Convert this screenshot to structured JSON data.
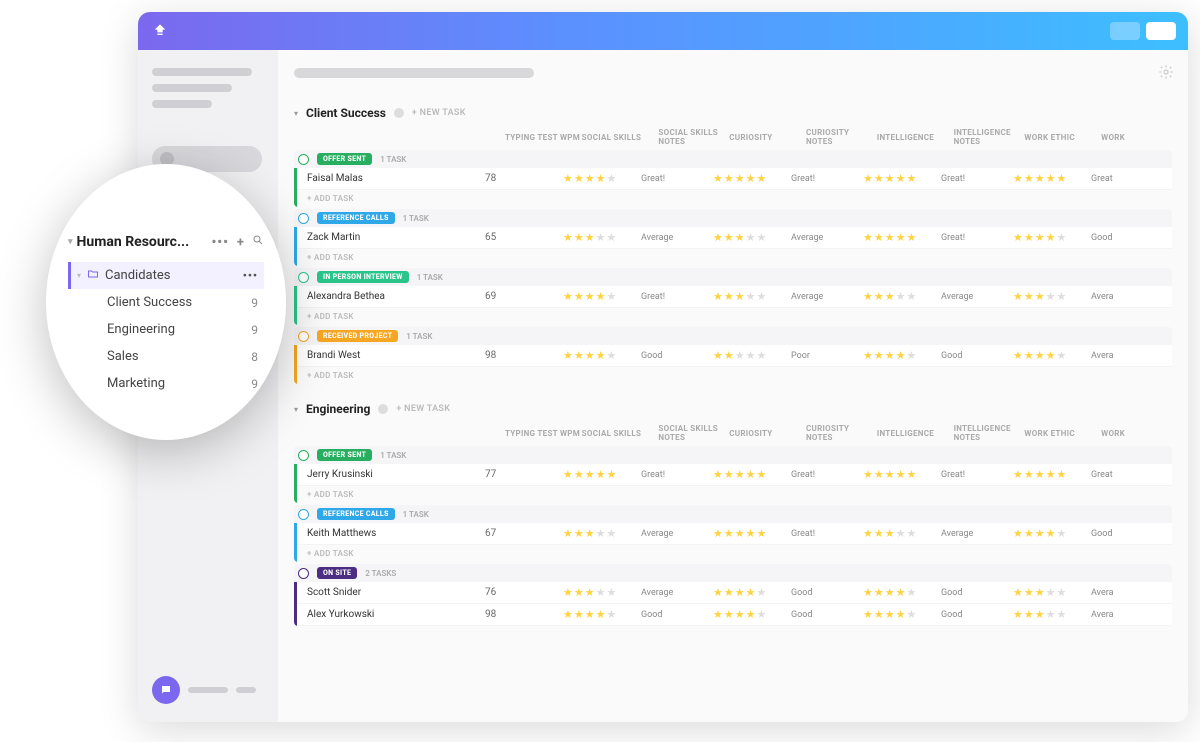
{
  "colors": {
    "offer_sent": "#27AE60",
    "reference_calls": "#2EA8E6",
    "in_person": "#2BC48A",
    "received": "#F5A623",
    "on_site": "#4B2E83"
  },
  "labels": {
    "new_task": "+ NEW TASK",
    "add_task": "+ ADD TASK",
    "task_singular": "1 TASK",
    "tasks_2": "2 TASKS"
  },
  "columns": [
    "TYPING TEST WPM",
    "SOCIAL SKILLS",
    "SOCIAL SKILLS NOTES",
    "CURIOSITY",
    "CURIOSITY NOTES",
    "INTELLIGENCE",
    "INTELLIGENCE NOTES",
    "WORK ETHIC",
    "WORK"
  ],
  "groups": [
    {
      "id": "client-success",
      "name": "Client Success",
      "statuses": [
        {
          "key": "offer_sent",
          "label": "OFFER SENT",
          "color": "#27AE60",
          "count": "1 TASK",
          "rows": [
            {
              "name": "Faisal Malas",
              "typing": "78",
              "stars": [
                4,
                5,
                5,
                5
              ],
              "notes": [
                "Great!",
                "Great!",
                "Great!",
                "Great"
              ]
            }
          ]
        },
        {
          "key": "reference_calls",
          "label": "REFERENCE CALLS",
          "color": "#2EA8E6",
          "count": "1 TASK",
          "rows": [
            {
              "name": "Zack Martin",
              "typing": "65",
              "stars": [
                3,
                3,
                5,
                4
              ],
              "notes": [
                "Average",
                "Average",
                "Great!",
                "Good"
              ]
            }
          ]
        },
        {
          "key": "in_person",
          "label": "IN PERSON INTERVIEW",
          "color": "#2BC48A",
          "count": "1 TASK",
          "rows": [
            {
              "name": "Alexandra Bethea",
              "typing": "69",
              "stars": [
                4,
                3,
                3,
                3
              ],
              "notes": [
                "Great!",
                "Average",
                "Average",
                "Avera"
              ]
            }
          ]
        },
        {
          "key": "received",
          "label": "RECEIVED PROJECT",
          "color": "#F5A623",
          "count": "1 TASK",
          "rows": [
            {
              "name": "Brandi West",
              "typing": "98",
              "stars": [
                4,
                2,
                4,
                4
              ],
              "notes": [
                "Good",
                "Poor",
                "Good",
                "Avera"
              ]
            }
          ]
        }
      ]
    },
    {
      "id": "engineering",
      "name": "Engineering",
      "statuses": [
        {
          "key": "offer_sent",
          "label": "OFFER SENT",
          "color": "#27AE60",
          "count": "1 TASK",
          "rows": [
            {
              "name": "Jerry Krusinski",
              "typing": "77",
              "stars": [
                5,
                5,
                5,
                5
              ],
              "notes": [
                "Great!",
                "Great!",
                "Great!",
                "Great"
              ]
            }
          ]
        },
        {
          "key": "reference_calls",
          "label": "REFERENCE CALLS",
          "color": "#2EA8E6",
          "count": "1 TASK",
          "rows": [
            {
              "name": "Keith Matthews",
              "typing": "67",
              "stars": [
                3,
                5,
                3,
                4
              ],
              "notes": [
                "Average",
                "Great!",
                "Average",
                "Good"
              ]
            }
          ]
        },
        {
          "key": "on_site",
          "label": "ON SITE",
          "color": "#4B2E83",
          "count": "2 TASKS",
          "rows": [
            {
              "name": "Scott Snider",
              "typing": "76",
              "stars": [
                3,
                4,
                4,
                3
              ],
              "notes": [
                "Average",
                "Good",
                "Good",
                "Avera"
              ]
            },
            {
              "name": "Alex Yurkowski",
              "typing": "98",
              "stars": [
                4,
                4,
                4,
                3
              ],
              "notes": [
                "Good",
                "Good",
                "Good",
                "Avera"
              ]
            }
          ]
        }
      ]
    }
  ],
  "zoom": {
    "space": "Human Resourc...",
    "active": "Candidates",
    "items": [
      {
        "label": "Client Success",
        "count": "9"
      },
      {
        "label": "Engineering",
        "count": "9"
      },
      {
        "label": "Sales",
        "count": "8"
      },
      {
        "label": "Marketing",
        "count": "9"
      }
    ]
  }
}
